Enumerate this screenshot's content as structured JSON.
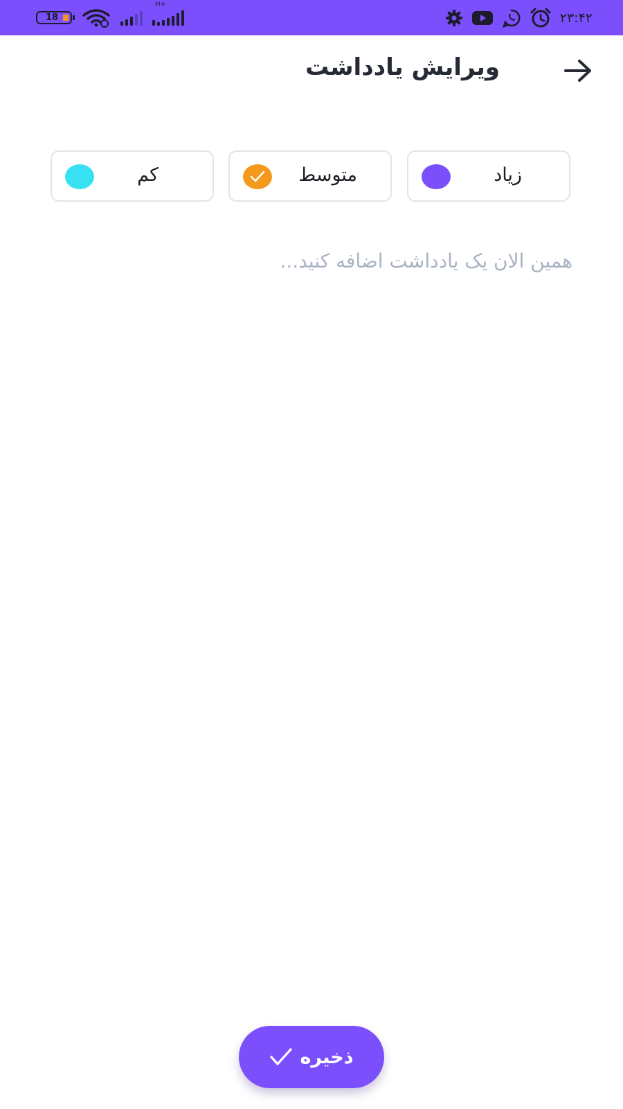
{
  "status_bar": {
    "time": "۲۳:۴۲",
    "battery_level": "18",
    "network_type": "H+",
    "background_color": "#7b4ffb",
    "icons": [
      "battery-icon",
      "wifi-icon",
      "signal-icon",
      "signal-hplus-icon",
      "settings-icon",
      "youtube-icon",
      "whatsapp-icon",
      "alarm-icon"
    ]
  },
  "header": {
    "title": "ویرایش یادداشت",
    "back_icon": "arrow-right-icon"
  },
  "priority": {
    "options": [
      {
        "label": "زیاد",
        "color": "#7b4ffb",
        "selected": false
      },
      {
        "label": "متوسط",
        "color": "#f39a1e",
        "selected": true
      },
      {
        "label": "کم",
        "color": "#37e1f1",
        "selected": false
      }
    ]
  },
  "note": {
    "value": "",
    "placeholder": "همین الان یک یادداشت اضافه کنید..."
  },
  "save_button": {
    "label": "ذخیره",
    "icon": "check-icon",
    "color": "#7b4ffb"
  }
}
